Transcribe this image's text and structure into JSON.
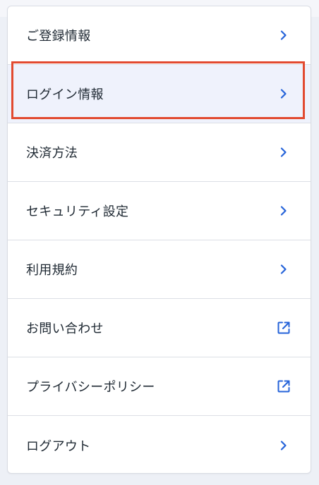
{
  "menu": {
    "items": [
      {
        "label": "ご登録情報",
        "icon": "chevron-right-icon"
      },
      {
        "label": "ログイン情報",
        "icon": "chevron-right-icon",
        "active": true
      },
      {
        "label": "決済方法",
        "icon": "chevron-right-icon"
      },
      {
        "label": "セキュリティ設定",
        "icon": "chevron-right-icon"
      },
      {
        "label": "利用規約",
        "icon": "chevron-right-icon"
      },
      {
        "label": "お問い合わせ",
        "icon": "external-link-icon"
      },
      {
        "label": "プライバシーポリシー",
        "icon": "external-link-icon"
      },
      {
        "label": "ログアウト",
        "icon": "chevron-right-icon"
      }
    ]
  },
  "colors": {
    "accent": "#2563d9",
    "highlight": "#e24a30",
    "active_background": "#eff2fc",
    "text": "#1f2933"
  }
}
